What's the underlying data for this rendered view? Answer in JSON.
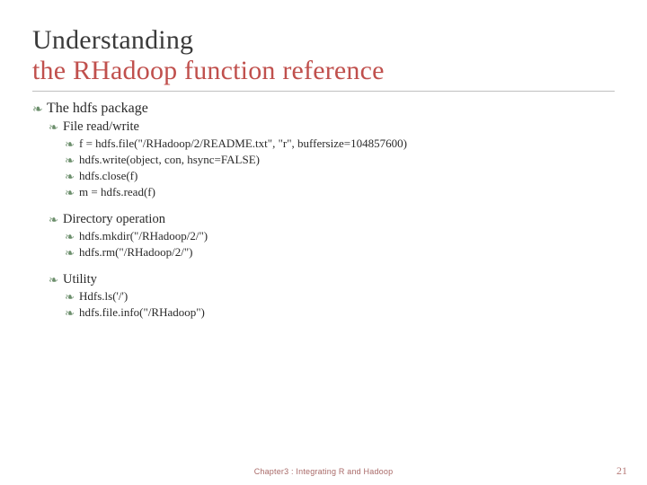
{
  "title": {
    "line1": "Understanding",
    "line2": "the RHadoop function reference"
  },
  "bullet_glyph": "❧",
  "sections": [
    {
      "heading": "The hdfs package",
      "groups": [
        {
          "heading": "File read/write",
          "items": [
            "f = hdfs.file(\"/RHadoop/2/README.txt\", \"r\", buffersize=104857600)",
            "hdfs.write(object, con, hsync=FALSE)",
            "hdfs.close(f)",
            "m = hdfs.read(f)"
          ]
        },
        {
          "heading": "Directory operation",
          "items": [
            "hdfs.mkdir(\"/RHadoop/2/\")",
            "hdfs.rm(\"/RHadoop/2/\")"
          ]
        },
        {
          "heading": "Utility",
          "items": [
            "Hdfs.ls('/')",
            "hdfs.file.info(\"/RHadoop\")"
          ]
        }
      ]
    }
  ],
  "footer": "Chapter3 : Integrating R and Hadoop",
  "page_number": "21"
}
